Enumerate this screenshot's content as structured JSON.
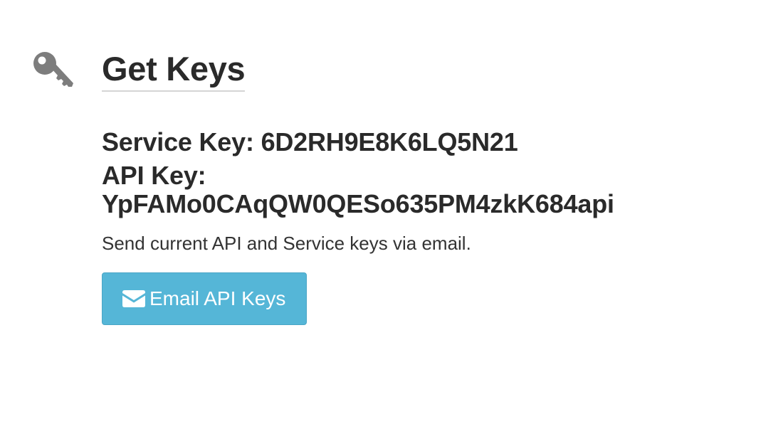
{
  "header": {
    "title": "Get Keys",
    "icon": "key-icon"
  },
  "keys": {
    "service_label": "Service Key:",
    "service_value": "6D2RH9E8K6LQ5N21",
    "api_label": "API Key:",
    "api_value": "YpFAMo0CAqQW0QESo635PM4zkK684api"
  },
  "hint": "Send current API and Service keys via email.",
  "email_button": {
    "label": "Email API Keys",
    "icon": "envelope-icon"
  },
  "colors": {
    "button_bg": "#55b6d7",
    "icon_gray": "#7a7a7a",
    "text": "#2a2a2a"
  }
}
